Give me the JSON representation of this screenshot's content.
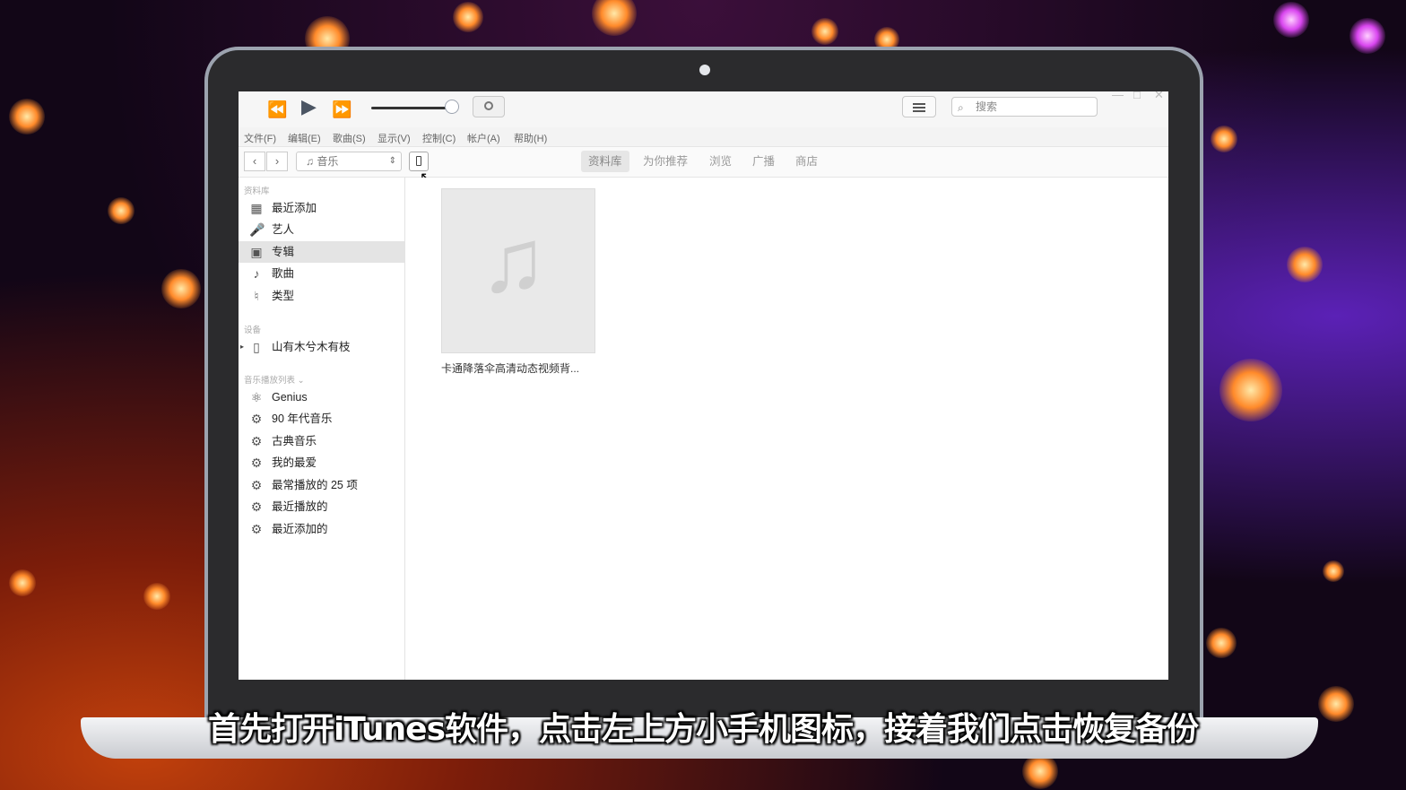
{
  "subtitle": "首先打开iTunes软件，点击左上方小手机图标，接着我们点击恢复备份",
  "itunes": {
    "search_placeholder": "搜索",
    "menu": [
      "文件(F)",
      "编辑(E)",
      "歌曲(S)",
      "显示(V)",
      "控制(C)",
      "帐户(A)",
      "帮助(H)"
    ],
    "media_kind": "音乐",
    "tabs": [
      "资料库",
      "为你推荐",
      "浏览",
      "广播",
      "商店"
    ],
    "active_tab": "资料库",
    "sidebar": {
      "library_header": "资料库",
      "library_items": [
        {
          "label": "最近添加",
          "icon": "calendar-grid-icon"
        },
        {
          "label": "艺人",
          "icon": "microphone-icon"
        },
        {
          "label": "专辑",
          "icon": "album-icon",
          "selected": true
        },
        {
          "label": "歌曲",
          "icon": "music-note-icon"
        },
        {
          "label": "类型",
          "icon": "genre-icon"
        }
      ],
      "devices_header": "设备",
      "device_name": "山有木兮木有枝",
      "playlists_header": "音乐播放列表",
      "playlists": [
        {
          "label": "Genius",
          "icon": "genius-atom-icon"
        },
        {
          "label": "90 年代音乐",
          "icon": "gear-icon"
        },
        {
          "label": "古典音乐",
          "icon": "gear-icon"
        },
        {
          "label": "我的最爱",
          "icon": "gear-icon"
        },
        {
          "label": "最常播放的 25 项",
          "icon": "gear-icon"
        },
        {
          "label": "最近播放的",
          "icon": "gear-icon"
        },
        {
          "label": "最近添加的",
          "icon": "gear-icon"
        }
      ]
    },
    "albums": [
      {
        "title": "卡通降落伞高清动态视频背..."
      }
    ]
  }
}
